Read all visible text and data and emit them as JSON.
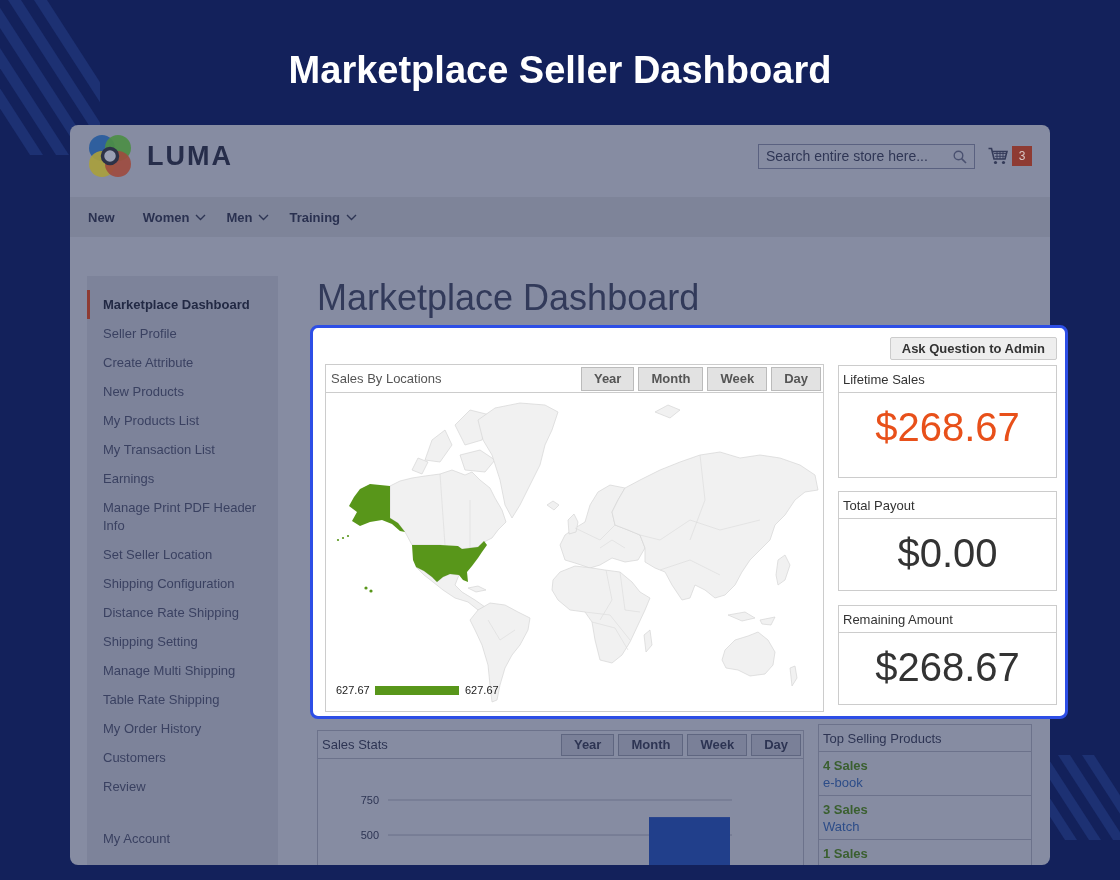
{
  "banner": {
    "title": "Marketplace Seller Dashboard"
  },
  "header": {
    "logo_text": "LUMA",
    "search": {
      "placeholder": "Search entire store here..."
    },
    "cart": {
      "count": "3"
    }
  },
  "nav": [
    {
      "label": "New",
      "has_menu": false
    },
    {
      "label": "Women",
      "has_menu": true
    },
    {
      "label": "Men",
      "has_menu": true
    },
    {
      "label": "Training",
      "has_menu": true
    }
  ],
  "sidebar": {
    "items": [
      {
        "label": "Marketplace Dashboard",
        "selected": true
      },
      {
        "label": "Seller Profile",
        "selected": false
      },
      {
        "label": "Create Attribute",
        "selected": false
      },
      {
        "label": "New Products",
        "selected": false
      },
      {
        "label": "My Products List",
        "selected": false
      },
      {
        "label": "My Transaction List",
        "selected": false
      },
      {
        "label": "Earnings",
        "selected": false
      },
      {
        "label": "Manage Print PDF Header Info",
        "selected": false
      },
      {
        "label": "Set Seller Location",
        "selected": false
      },
      {
        "label": "Shipping Configuration",
        "selected": false
      },
      {
        "label": "Distance Rate Shipping",
        "selected": false
      },
      {
        "label": "Shipping Setting",
        "selected": false
      },
      {
        "label": "Manage Multi Shipping",
        "selected": false
      },
      {
        "label": "Table Rate Shipping",
        "selected": false
      },
      {
        "label": "My Order History",
        "selected": false
      },
      {
        "label": "Customers",
        "selected": false
      },
      {
        "label": "Review",
        "selected": false
      }
    ],
    "account_items": [
      {
        "label": "My Account",
        "selected": false
      }
    ]
  },
  "page_title": "Marketplace Dashboard",
  "spotlight": {
    "action_button": "Ask Question to Admin",
    "sales_by_locations": {
      "title": "Sales By Locations",
      "periods": [
        "Year",
        "Month",
        "Week",
        "Day"
      ],
      "legend": {
        "min": "627.67",
        "max": "627.67"
      }
    },
    "summary_cards": [
      {
        "title": "Lifetime Sales",
        "value": "$268.67",
        "accent": true
      },
      {
        "title": "Total Payout",
        "value": "$0.00",
        "accent": false
      },
      {
        "title": "Remaining Amount",
        "value": "$268.67",
        "accent": false
      }
    ]
  },
  "sales_stats": {
    "title": "Sales Stats",
    "periods": [
      "Year",
      "Month",
      "Week",
      "Day"
    ],
    "chart_data": {
      "type": "bar",
      "values": [
        628
      ],
      "ylim": [
        286,
        750
      ],
      "yticks": [
        500,
        750
      ]
    }
  },
  "top_selling": {
    "title": "Top Selling Products",
    "items": [
      {
        "sales": "4 Sales",
        "product": "e-book"
      },
      {
        "sales": "3 Sales",
        "product": "Watch"
      },
      {
        "sales": "1 Sales"
      }
    ]
  }
}
